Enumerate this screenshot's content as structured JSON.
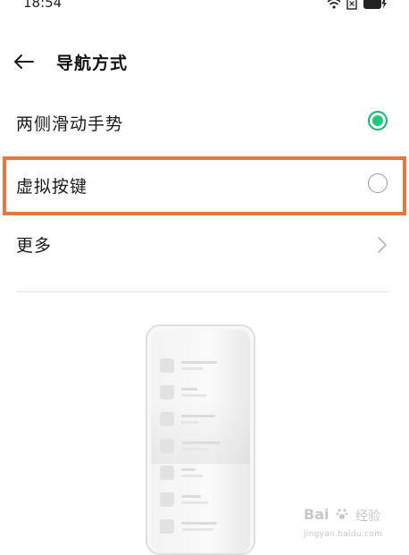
{
  "status_bar": {
    "time": "18:54",
    "icons": [
      "wifi-icon",
      "sim-icon",
      "battery-charging-icon"
    ]
  },
  "header": {
    "back_icon": "arrow-left-icon",
    "title": "导航方式"
  },
  "options": [
    {
      "label": "两侧滑动手势",
      "control": "radio",
      "selected": true
    },
    {
      "label": "虚拟按键",
      "control": "radio",
      "selected": false
    },
    {
      "label": "更多",
      "control": "chevron"
    }
  ],
  "colors": {
    "radio_selected": "#1ec97a",
    "highlight_border": "#e6773f",
    "text": "#1a1a1a"
  },
  "watermark": {
    "logo_text": "Bai",
    "suffix_text": "经验",
    "url": "jingyan.baidu.com"
  }
}
